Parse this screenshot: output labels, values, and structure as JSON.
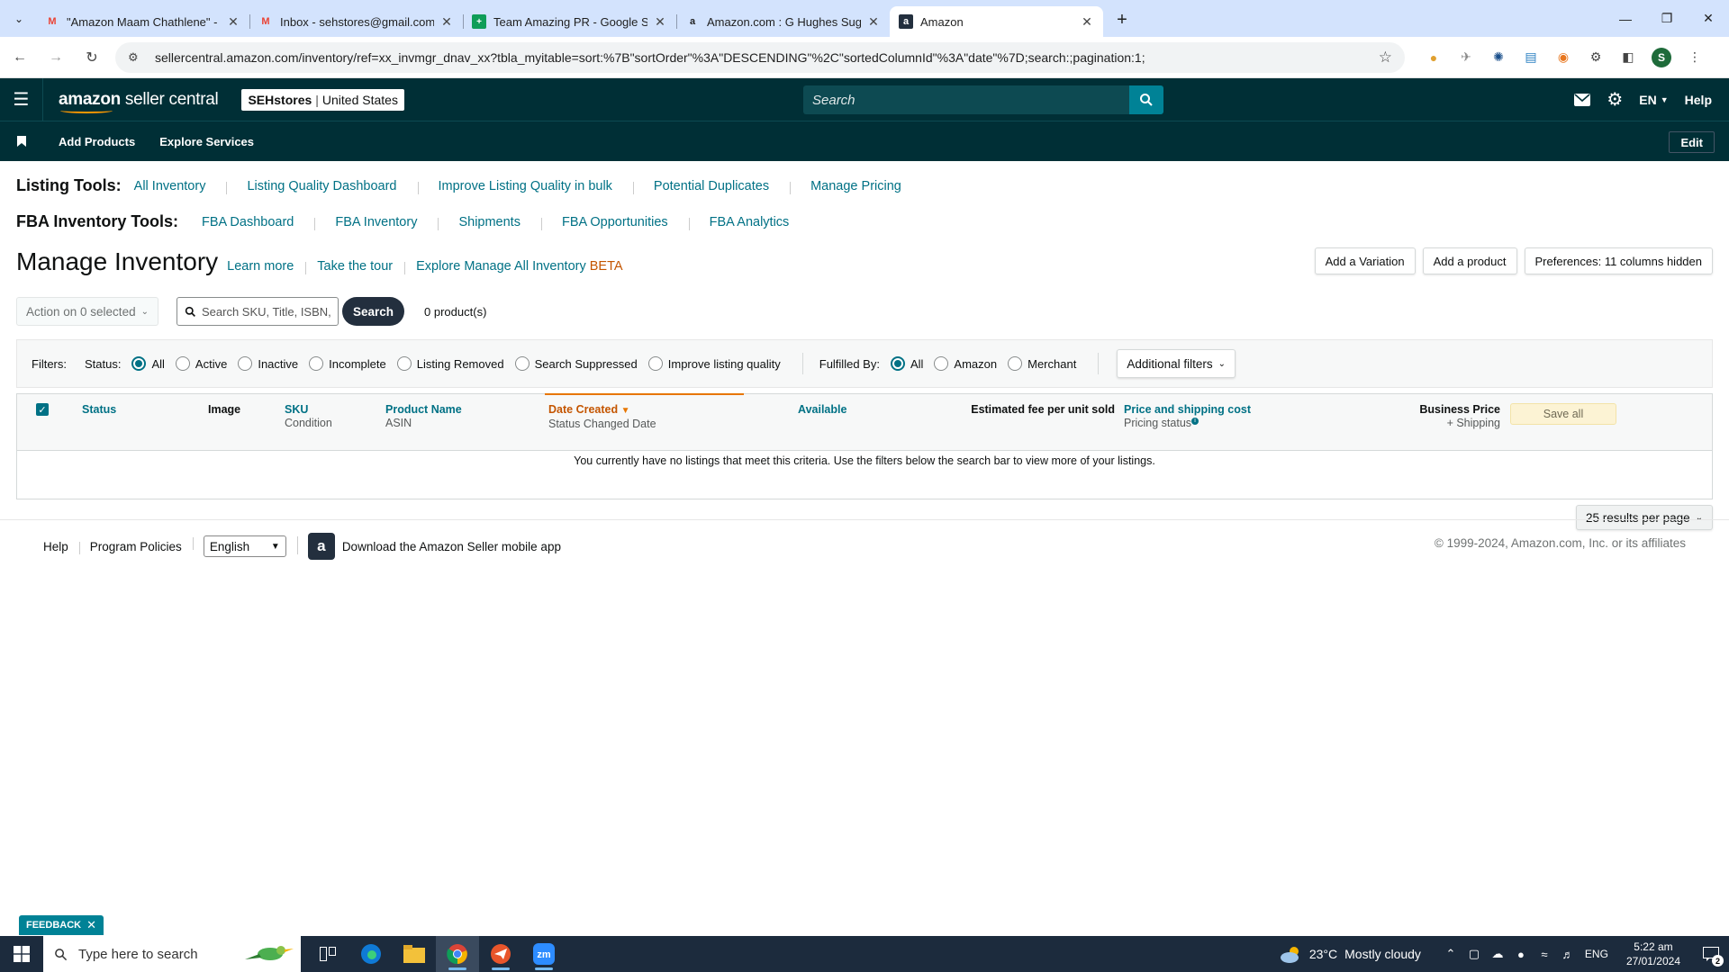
{
  "browser": {
    "tabs": [
      {
        "title": "\"Amazon Maam Chathlene\" - c",
        "favicon": "gmail-icon",
        "active": false
      },
      {
        "title": "Inbox - sehstores@gmail.com -",
        "favicon": "gmail-icon",
        "active": false
      },
      {
        "title": "Team Amazing PR - Google She",
        "favicon": "sheets-icon",
        "active": false
      },
      {
        "title": "Amazon.com : G Hughes Sugar",
        "favicon": "amazon-icon",
        "active": false
      },
      {
        "title": "Amazon",
        "favicon": "amazon-icon",
        "active": true
      }
    ],
    "url": "sellercentral.amazon.com/inventory/ref=xx_invmgr_dnav_xx?tbla_myitable=sort:%7B\"sortOrder\"%3A\"DESCENDING\"%2C\"sortedColumnId\"%3A\"date\"%7D;search:;pagination:1;",
    "profile_initial": "S"
  },
  "header": {
    "logo_bold": "amazon",
    "logo_light": " seller central",
    "store_name": "SEHstores",
    "store_region": "United States",
    "search_placeholder": "Search",
    "language": "EN",
    "help": "Help"
  },
  "subnav": {
    "items": [
      "Add Products",
      "Explore Services"
    ],
    "edit": "Edit"
  },
  "listing_tools": {
    "label": "Listing Tools:",
    "links": [
      "All Inventory",
      "Listing Quality Dashboard",
      "Improve Listing Quality in bulk",
      "Potential Duplicates",
      "Manage Pricing"
    ]
  },
  "fba_tools": {
    "label": "FBA Inventory Tools:",
    "links": [
      "FBA Dashboard",
      "FBA Inventory",
      "Shipments",
      "FBA Opportunities",
      "FBA Analytics"
    ]
  },
  "page": {
    "title": "Manage Inventory",
    "learn_more": "Learn more",
    "take_tour": "Take the tour",
    "explore": "Explore Manage All Inventory",
    "beta": "BETA",
    "buttons": [
      "Add a Variation",
      "Add a product",
      "Preferences: 11 columns hidden"
    ]
  },
  "actions": {
    "action_dropdown": "Action on 0 selected",
    "search_placeholder": "Search SKU, Title, ISBN,",
    "search_button": "Search",
    "product_count": "0 product(s)"
  },
  "filters": {
    "label": "Filters:",
    "status_label": "Status:",
    "status_options": [
      "All",
      "Active",
      "Inactive",
      "Incomplete",
      "Listing Removed",
      "Search Suppressed",
      "Improve listing quality"
    ],
    "status_selected": 0,
    "fulfilled_label": "Fulfilled By:",
    "fulfilled_options": [
      "All",
      "Amazon",
      "Merchant"
    ],
    "fulfilled_selected": 0,
    "additional": "Additional filters"
  },
  "table": {
    "columns": {
      "status": "Status",
      "image": "Image",
      "sku": "SKU",
      "condition": "Condition",
      "product_name": "Product Name",
      "asin": "ASIN",
      "date_created": "Date Created",
      "status_changed": "Status Changed Date",
      "available": "Available",
      "est_fee": "Estimated fee per unit sold",
      "price": "Price and shipping cost",
      "pricing_status": "Pricing status",
      "business_price": "Business Price",
      "plus_shipping": "+ Shipping"
    },
    "save_all": "Save all",
    "empty_message": "You currently have no listings that meet this criteria. Use the filters below the search bar to view more of your listings."
  },
  "pagination": {
    "results_per_page": "25 results per page"
  },
  "footer": {
    "help": "Help",
    "program_policies": "Program Policies",
    "language": "English",
    "app_download": "Download the Amazon Seller mobile app",
    "copyright": "© 1999-2024, Amazon.com, Inc. or its affiliates"
  },
  "feedback": {
    "label": "FEEDBACK"
  },
  "taskbar": {
    "search_placeholder": "Type here to search",
    "weather_temp": "23°C",
    "weather_desc": "Mostly cloudy",
    "lang": "ENG",
    "time": "5:22 am",
    "date": "27/01/2024",
    "notifications": "2"
  }
}
